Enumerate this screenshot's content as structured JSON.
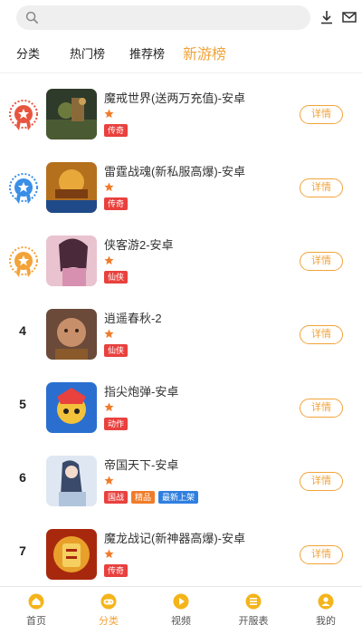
{
  "search": {
    "placeholder": ""
  },
  "tabs": [
    {
      "label": "分类",
      "active": false
    },
    {
      "label": "热门榜",
      "active": false
    },
    {
      "label": "推荐榜",
      "active": false
    },
    {
      "label": "新游榜",
      "active": true
    }
  ],
  "colors": {
    "accent": "#f2a33a",
    "tag_red": "#e8413e",
    "tag_orange": "#f07c2a",
    "tag_blue": "#2f7fe0",
    "medal_red": "#e8553e",
    "medal_blue": "#3a8ee6",
    "medal_orange": "#f2a33a"
  },
  "games": [
    {
      "rank": "1",
      "medal": "medal-red-icon",
      "title": "魔戒世界(送两万充值)-安卓",
      "stars": 1,
      "tags": [
        {
          "label": "传奇",
          "color": "#e8413e"
        }
      ],
      "button": "详情"
    },
    {
      "rank": "2",
      "medal": "medal-blue-icon",
      "title": "雷霆战魂(新私服高爆)-安卓",
      "stars": 1,
      "tags": [
        {
          "label": "传奇",
          "color": "#e8413e"
        }
      ],
      "button": "详情"
    },
    {
      "rank": "3",
      "medal": "medal-orange-icon",
      "title": "侠客游2-安卓",
      "stars": 1,
      "tags": [
        {
          "label": "仙侠",
          "color": "#e8413e"
        }
      ],
      "button": "详情"
    },
    {
      "rank": "4",
      "medal": "",
      "title": "逍遥春秋-2",
      "stars": 1,
      "tags": [
        {
          "label": "仙侠",
          "color": "#e8413e"
        }
      ],
      "button": "详情"
    },
    {
      "rank": "5",
      "medal": "",
      "title": "指尖炮弹-安卓",
      "stars": 1,
      "tags": [
        {
          "label": "动作",
          "color": "#e8413e"
        }
      ],
      "button": "详情"
    },
    {
      "rank": "6",
      "medal": "",
      "title": "帝国天下-安卓",
      "stars": 1,
      "tags": [
        {
          "label": "国战",
          "color": "#e8413e"
        },
        {
          "label": "精品",
          "color": "#f07c2a"
        },
        {
          "label": "最新上架",
          "color": "#2f7fe0"
        }
      ],
      "button": "详情"
    },
    {
      "rank": "7",
      "medal": "",
      "title": "魔龙战记(新神器高爆)-安卓",
      "stars": 1,
      "tags": [
        {
          "label": "传奇",
          "color": "#e8413e"
        }
      ],
      "button": "详情"
    }
  ],
  "bottom_nav": [
    {
      "label": "首页",
      "icon": "home-icon",
      "active": false
    },
    {
      "label": "分类",
      "icon": "gamepad-icon",
      "active": true
    },
    {
      "label": "视频",
      "icon": "play-icon",
      "active": false
    },
    {
      "label": "开服表",
      "icon": "server-list-icon",
      "active": false
    },
    {
      "label": "我的",
      "icon": "profile-icon",
      "active": false
    }
  ]
}
